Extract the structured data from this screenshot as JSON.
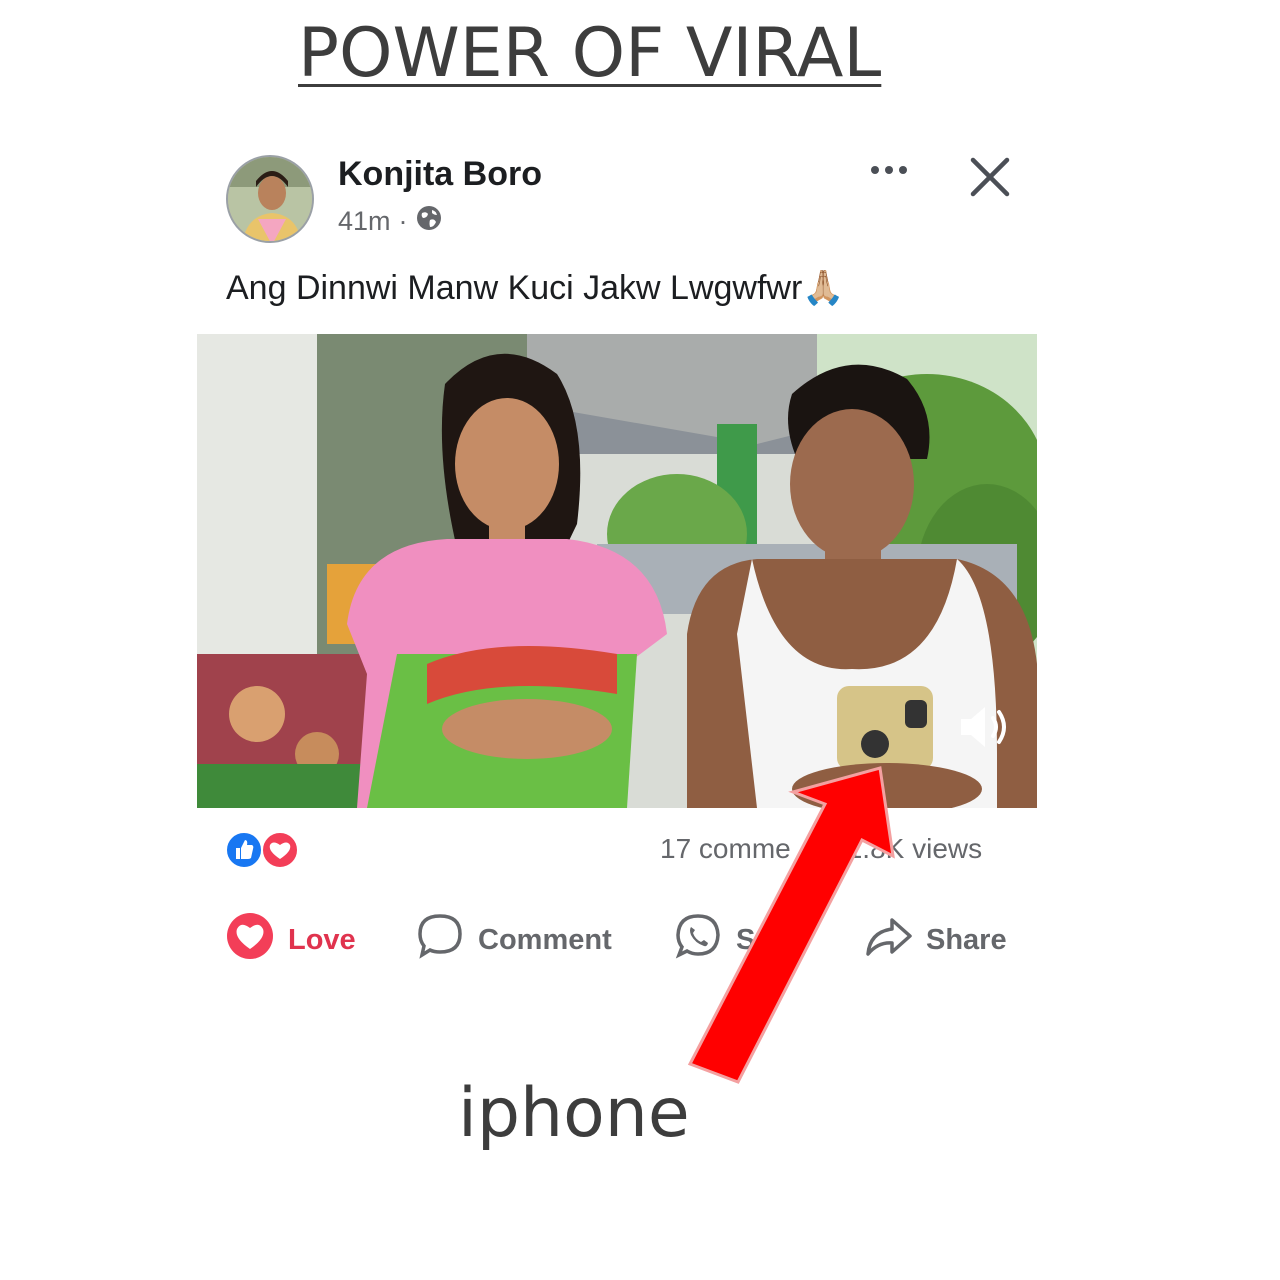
{
  "headline": "POWER OF VIRAL",
  "post": {
    "author": "Konjita Boro",
    "time": "41m",
    "caption": "Ang Dinnwi Manw Kuci Jakw Lwgwfwr🙏🏼"
  },
  "stats": {
    "comments": "17 comme",
    "views": "1.8K views"
  },
  "actions": {
    "love": "Love",
    "comment": "Comment",
    "send": "S",
    "share": "Share"
  },
  "annotation": {
    "label": "iphone"
  },
  "colors": {
    "love": "#e0334e",
    "like": "#1877f2",
    "arrow": "#ff0000",
    "muted_text": "#65676b"
  },
  "icons": [
    "globe-icon",
    "more-icon",
    "close-icon",
    "volume-icon",
    "like-reaction-icon",
    "love-reaction-icon",
    "heart-icon",
    "comment-icon",
    "whatsapp-icon",
    "share-icon"
  ]
}
